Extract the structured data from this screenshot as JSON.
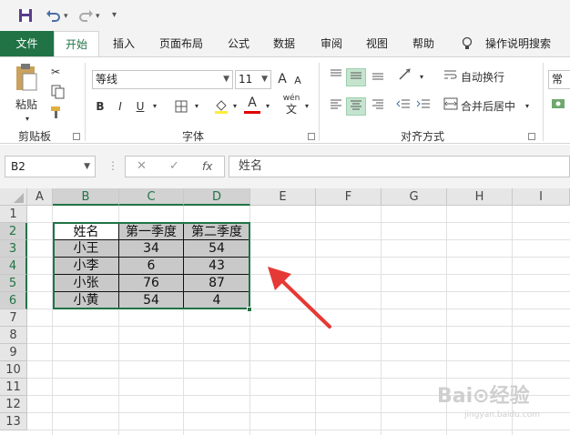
{
  "qat": {
    "save_icon": "save-icon",
    "undo_icon": "undo-icon",
    "redo_icon": "redo-icon",
    "customize_icon": "chevron-down-icon"
  },
  "tabs": [
    {
      "label": "文件"
    },
    {
      "label": "开始"
    },
    {
      "label": "插入"
    },
    {
      "label": "页面布局"
    },
    {
      "label": "公式"
    },
    {
      "label": "数据"
    },
    {
      "label": "审阅"
    },
    {
      "label": "视图"
    },
    {
      "label": "帮助"
    }
  ],
  "tell_me": {
    "label": "操作说明搜索",
    "icon": "lightbulb-icon"
  },
  "ribbon": {
    "clipboard": {
      "paste_label": "粘贴",
      "group_label": "剪贴板"
    },
    "font": {
      "font_name": "等线",
      "font_size": "11",
      "bold": "B",
      "italic": "I",
      "underline": "U",
      "grow": "A",
      "shrink": "A",
      "font_color": "A",
      "wen": "wén",
      "wen2": "文",
      "group_label": "字体"
    },
    "alignment": {
      "wrap_text": "自动换行",
      "merge_center": "合并后居中",
      "group_label": "对齐方式"
    },
    "number": {
      "format": "常规"
    }
  },
  "formula_bar": {
    "name_box": "B2",
    "fx": "fx",
    "content": "姓名"
  },
  "columns": [
    "A",
    "B",
    "C",
    "D",
    "E",
    "F",
    "G",
    "H",
    "I"
  ],
  "rows": [
    "1",
    "2",
    "3",
    "4",
    "5",
    "6",
    "7",
    "8",
    "9",
    "10",
    "11",
    "12",
    "13"
  ],
  "table": {
    "header": [
      "姓名",
      "第一季度",
      "第二季度"
    ],
    "rows": [
      [
        "小王",
        "34",
        "54"
      ],
      [
        "小李",
        "6",
        "43"
      ],
      [
        "小张",
        "76",
        "87"
      ],
      [
        "小黄",
        "54",
        "4"
      ]
    ]
  },
  "watermark": {
    "text": "Bai⊙经验",
    "sub": "jingyan.baidu.com"
  },
  "colors": {
    "accent": "#217346",
    "selection_fill": "#c9c9c9",
    "arrow": "#e53935"
  }
}
